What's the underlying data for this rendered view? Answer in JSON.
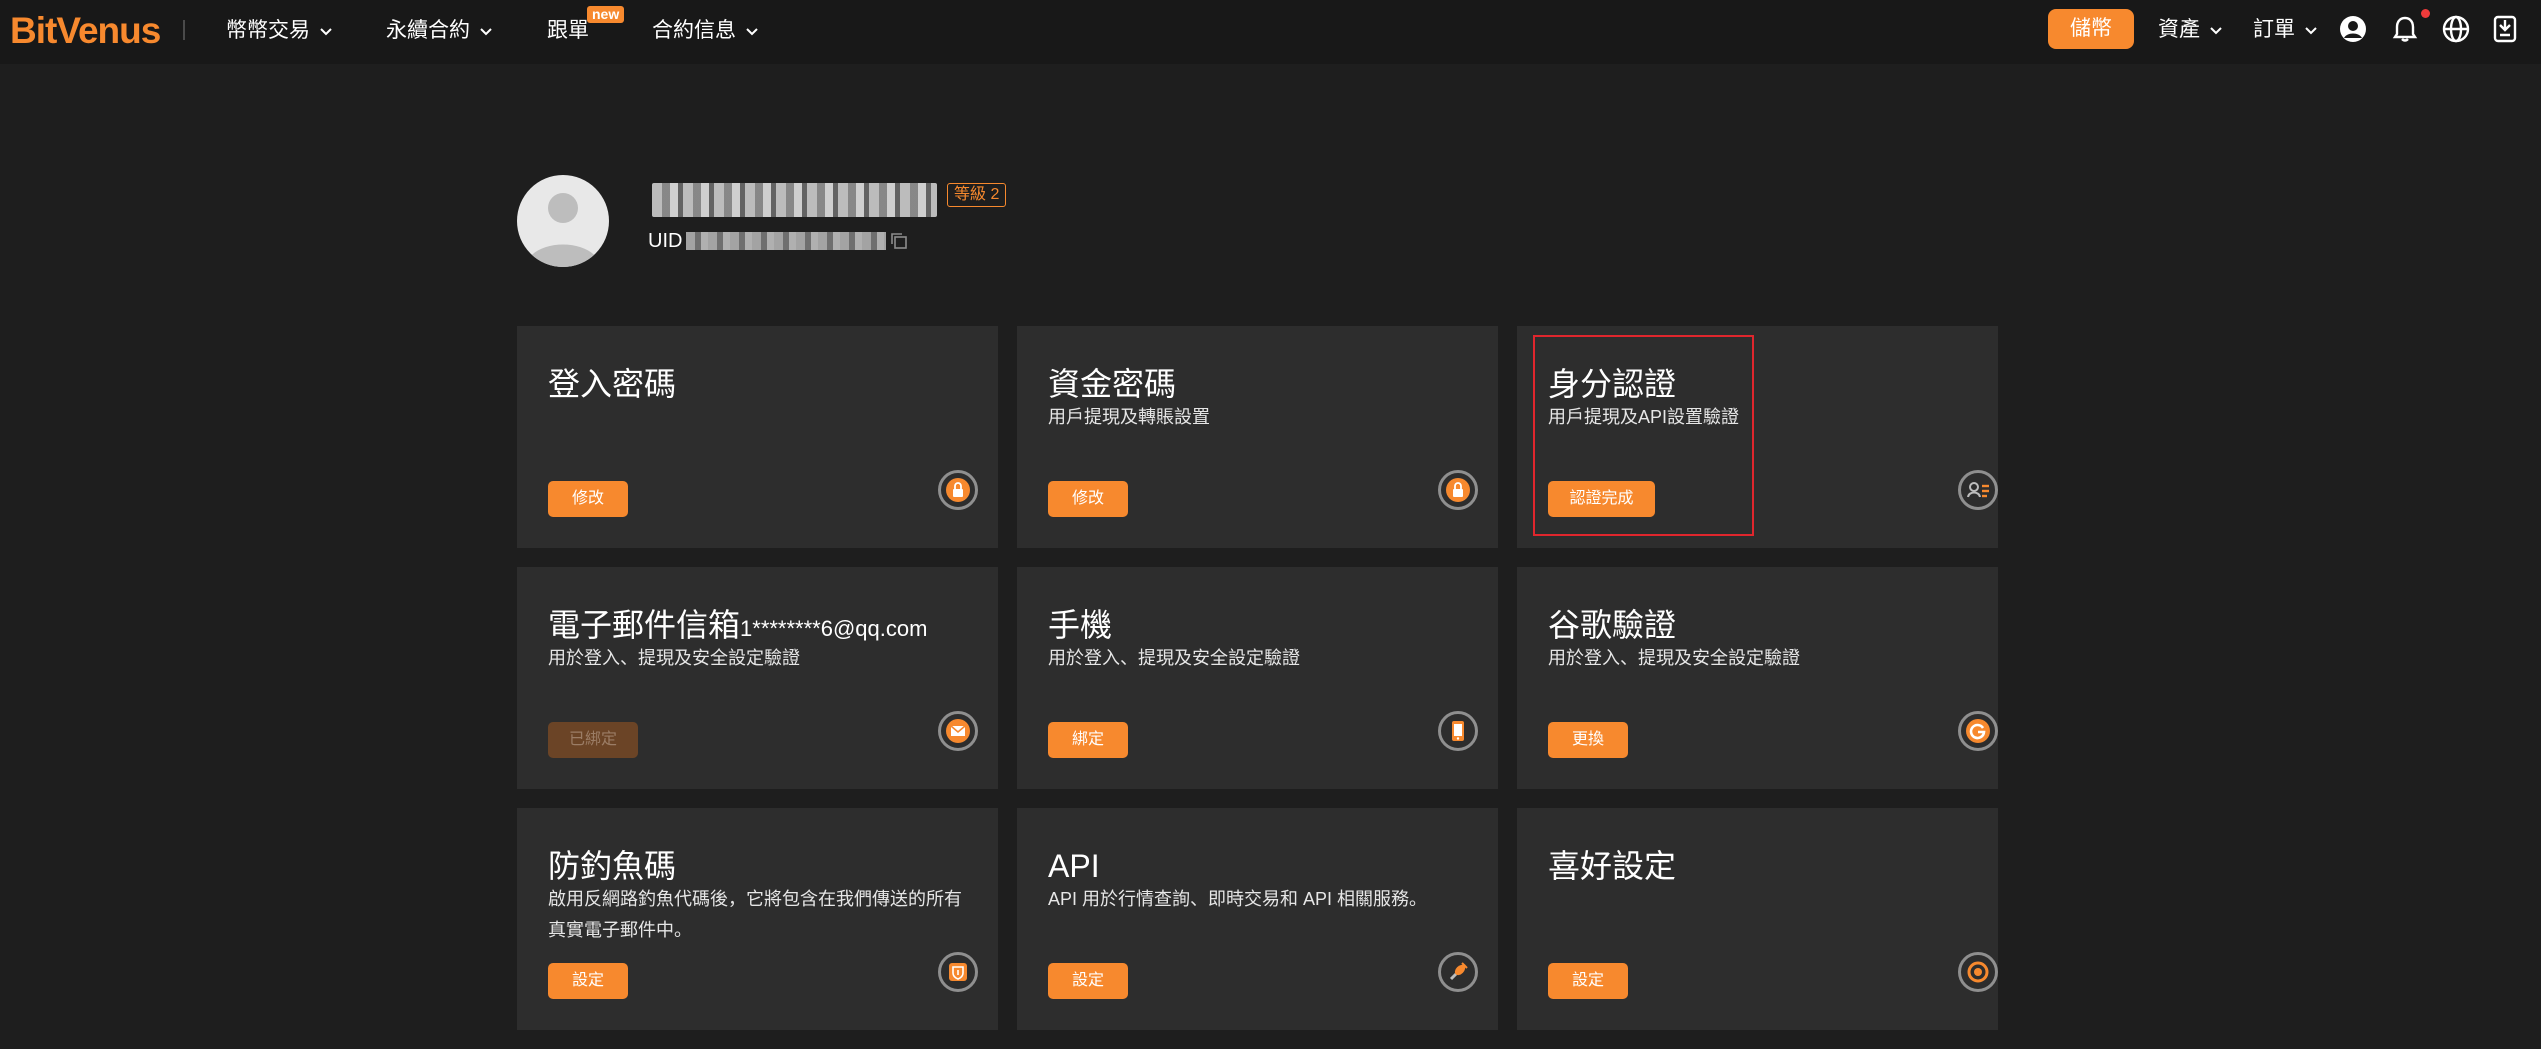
{
  "brand": {
    "logo_text": "BitVenus",
    "accent": "#f7892e"
  },
  "nav": {
    "items": [
      {
        "label": "幣幣交易"
      },
      {
        "label": "永續合約"
      },
      {
        "label": "跟單",
        "badge": "new"
      },
      {
        "label": "合約信息"
      }
    ]
  },
  "topbar_right": {
    "deposit": "儲幣",
    "assets": "資產",
    "orders": "訂單",
    "icons": [
      "user-circle-icon",
      "bell-icon",
      "globe-icon",
      "download-app-icon"
    ]
  },
  "profile": {
    "level": "等級 2",
    "uid_label": "UID"
  },
  "cards": [
    {
      "title": "登入密碼",
      "desc": "",
      "button": "修改",
      "icon": "lock-icon"
    },
    {
      "title": "資金密碼",
      "desc": "用戶提現及轉賬設置",
      "button": "修改",
      "icon": "lock-icon"
    },
    {
      "title": "身分認證",
      "desc": "用戶提現及API設置驗證",
      "button": "認證完成",
      "icon": "id-card-icon"
    },
    {
      "title": "電子郵件信箱",
      "email": "1********6@qq.com",
      "desc": "用於登入、提現及安全設定驗證",
      "button": "已綁定",
      "button_disabled": true,
      "icon": "envelope-icon"
    },
    {
      "title": "手機",
      "desc": "用於登入、提現及安全設定驗證",
      "button": "綁定",
      "icon": "phone-icon"
    },
    {
      "title": "谷歌驗證",
      "desc": "用於登入、提現及安全設定驗證",
      "button": "更換",
      "icon": "google-icon"
    },
    {
      "title": "防釣魚碼",
      "desc": "啟用反網路釣魚代碼後，它將包含在我們傳送的所有真實電子郵件中。",
      "button": "設定",
      "icon": "shield-icon"
    },
    {
      "title": "API",
      "desc": "API 用於行情查詢、即時交易和 API 相關服務。",
      "button": "設定",
      "icon": "plug-icon"
    },
    {
      "title": "喜好設定",
      "desc": "",
      "button": "設定",
      "icon": "settings-icon"
    }
  ]
}
